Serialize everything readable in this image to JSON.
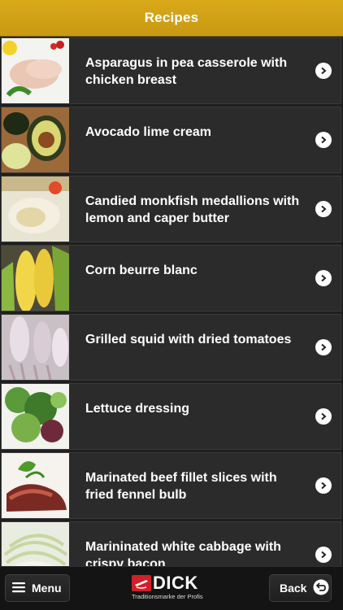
{
  "header": {
    "title": "Recipes"
  },
  "recipes": [
    {
      "title": "Asparagus in pea casserole with chicken breast",
      "thumb_icon": "chicken-breast-photo"
    },
    {
      "title": "Avocado lime cream",
      "thumb_icon": "avocado-photo"
    },
    {
      "title": "Candied monkfish medallions with lemon and caper butter",
      "thumb_icon": "monkfish-photo"
    },
    {
      "title": "Corn beurre blanc",
      "thumb_icon": "corn-photo"
    },
    {
      "title": "Grilled squid with dried tomatoes",
      "thumb_icon": "squid-photo"
    },
    {
      "title": "Lettuce dressing",
      "thumb_icon": "lettuce-photo"
    },
    {
      "title": "Marinated beef fillet slices with fried fennel bulb",
      "thumb_icon": "beef-fillet-photo"
    },
    {
      "title": "Marininated white cabbage with crispy bacon",
      "thumb_icon": "cabbage-photo"
    }
  ],
  "footer": {
    "menu_label": "Menu",
    "back_label": "Back",
    "logo_word": "DICK",
    "logo_tagline": "Traditionsmarke der Profis"
  },
  "colors": {
    "header": "#d1a116",
    "row_bg": "#2b2b2b",
    "logo_red": "#d0202a"
  }
}
